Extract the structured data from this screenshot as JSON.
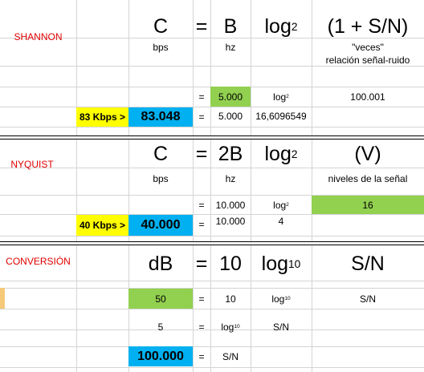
{
  "shannon": {
    "label": "SHANNON",
    "formula": {
      "c": "C",
      "eq": "=",
      "b": "B",
      "log": "log",
      "log_base": "2",
      "expr": "(1 + S/N)"
    },
    "units": {
      "c": "bps",
      "b": "hz",
      "expr_line1": "\"veces\"",
      "expr_line2": "relación señal-ruido"
    },
    "row1": {
      "eq": "=",
      "b": "5.000",
      "log": "log",
      "log_base": "2",
      "expr": "100.001"
    },
    "row2": {
      "tag": "83 Kbps >",
      "c": "83.048",
      "eq": "=",
      "b": "5.000",
      "log": "16,6096549"
    }
  },
  "nyquist": {
    "label": "NYQUIST",
    "formula": {
      "c": "C",
      "eq": "=",
      "b": "2B",
      "log": "log",
      "log_base": "2",
      "expr": "(V)"
    },
    "units": {
      "c": "bps",
      "b": "hz",
      "expr": "niveles de la señal"
    },
    "row1": {
      "eq": "=",
      "b": "10.000",
      "log": "log",
      "log_base": "2",
      "expr": "16"
    },
    "row2": {
      "tag": "40 Kbps >",
      "c": "40.000",
      "eq": "=",
      "b": "10.000",
      "log": "4"
    }
  },
  "conversion": {
    "label": "CONVERSIÓN",
    "formula": {
      "c": "dB",
      "eq": "=",
      "b": "10",
      "log": "log",
      "log_base": "10",
      "expr": "S/N"
    },
    "row1": {
      "c": "50",
      "eq": "=",
      "b": "10",
      "log": "log",
      "log_base": "10",
      "expr": "S/N"
    },
    "row2": {
      "c": "5",
      "eq": "=",
      "b": "log",
      "b_base": "10",
      "log": "S/N"
    },
    "row3": {
      "c": "100.000",
      "eq": "=",
      "b": "S/N"
    }
  },
  "colors": {
    "green": "#92d050",
    "blue": "#00b0f0",
    "yellow": "#ffff00",
    "label_red": "#e00000"
  }
}
